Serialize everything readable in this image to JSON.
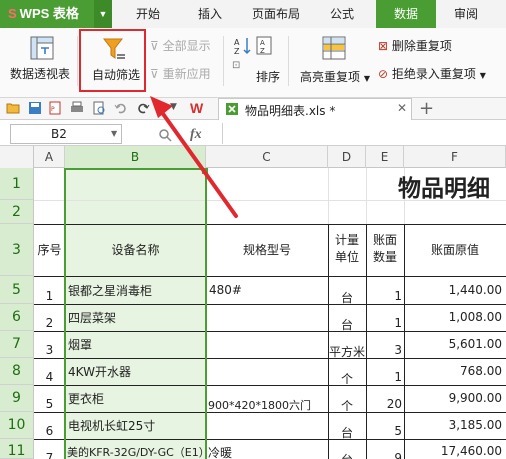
{
  "menubar": {
    "app_name": "WPS 表格",
    "tabs": [
      "开始",
      "插入",
      "页面布局",
      "公式",
      "数据",
      "审阅"
    ],
    "active_tab": "数据"
  },
  "ribbon": {
    "pivot_table": "数据透视表",
    "auto_filter": "自动筛选",
    "show_all": "全部显示",
    "reapply": "重新应用",
    "sort": "排序",
    "highlight_duplicates": "高亮重复项",
    "remove_duplicates": "删除重复项",
    "reject_duplicates": "拒绝录入重复项"
  },
  "document": {
    "tab_label": "物品明细表.xls *"
  },
  "formula_bar": {
    "name_box": "B2",
    "fx": "fx"
  },
  "columns": [
    "A",
    "B",
    "C",
    "D",
    "E",
    "F"
  ],
  "rows": [
    "1",
    "2",
    "3",
    "5",
    "6",
    "7",
    "8",
    "9",
    "10",
    "11"
  ],
  "sheet": {
    "title": "物品明细",
    "headers": {
      "seq": "序号",
      "name": "设备名称",
      "spec": "规格型号",
      "unit_line1": "计量",
      "unit_line2": "单位",
      "qty_line1": "账面",
      "qty_line2": "数量",
      "value": "账面原值"
    },
    "data": [
      {
        "seq": "1",
        "name": "银都之星消毒柜",
        "spec": "480#",
        "unit": "台",
        "qty": "1",
        "value": "1,440.00"
      },
      {
        "seq": "2",
        "name": "四层菜架",
        "spec": "",
        "unit": "台",
        "qty": "1",
        "value": "1,008.00"
      },
      {
        "seq": "3",
        "name": "烟罩",
        "spec": "",
        "unit": "平方米",
        "qty": "3",
        "value": "5,601.00"
      },
      {
        "seq": "4",
        "name": "4KW开水器",
        "spec": "",
        "unit": "个",
        "qty": "1",
        "value": "768.00"
      },
      {
        "seq": "5",
        "name": "更衣柜",
        "spec": "900*420*1800六门",
        "unit": "个",
        "qty": "20",
        "value": "9,900.00"
      },
      {
        "seq": "6",
        "name": "电视机长虹25寸",
        "spec": "",
        "unit": "台",
        "qty": "5",
        "value": "3,185.00"
      },
      {
        "seq": "7",
        "name": "美的KFR-32G/DY-GC（E1）",
        "spec": "冷暖",
        "unit": "台",
        "qty": "9",
        "value": "17,460.00"
      }
    ]
  },
  "colors": {
    "accent": "#4a9d32",
    "selection": "#e8f4e2",
    "highlight_border": "#e0282e"
  }
}
